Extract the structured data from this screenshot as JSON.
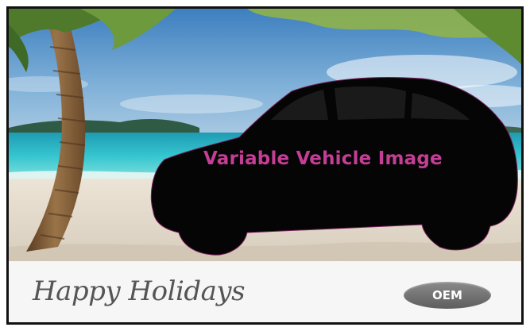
{
  "scene": {
    "vehicle_placeholder_label": "Variable Vehicle Image"
  },
  "footer": {
    "greeting": "Happy Holidays",
    "badge": "OEM"
  },
  "colors": {
    "vehicle_label": "#c43e96",
    "border": "#111111",
    "badge": "#707070",
    "greeting": "#555555"
  },
  "icons": [
    "palm-tree-icon",
    "car-silhouette-icon"
  ]
}
